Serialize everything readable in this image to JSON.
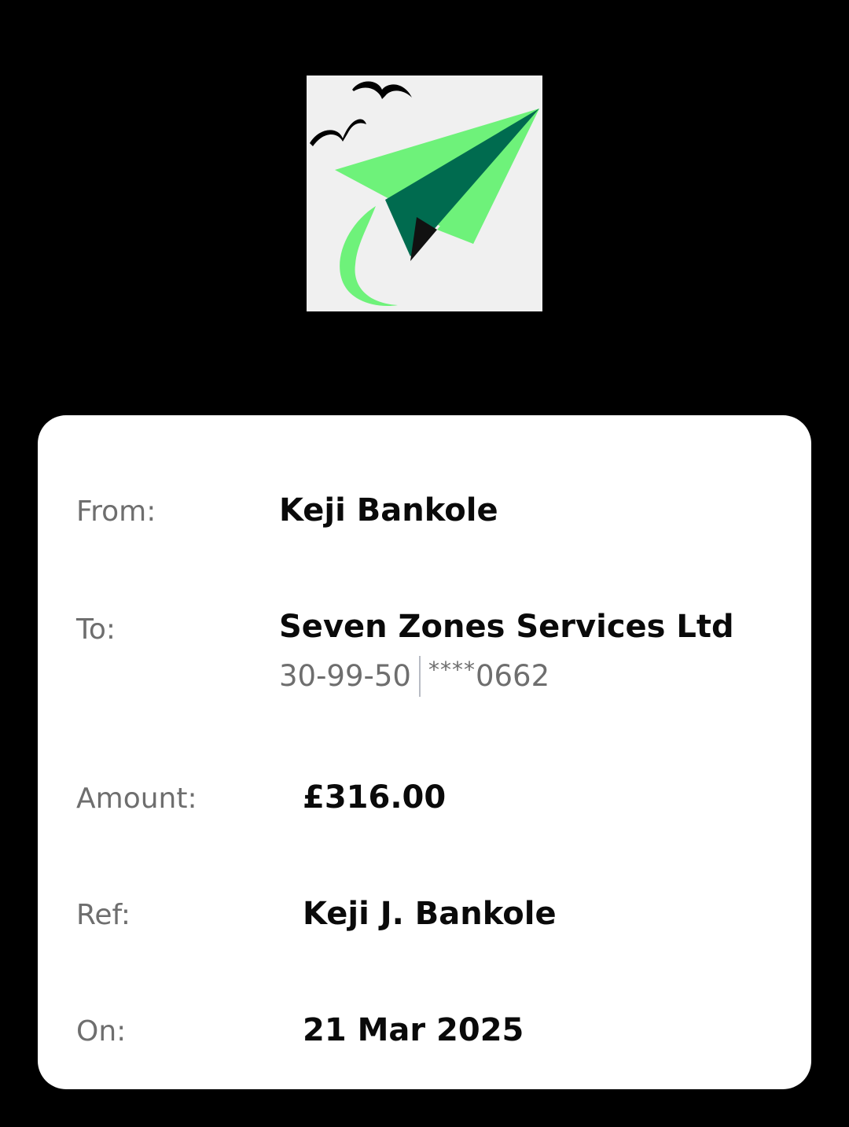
{
  "logo": {
    "icon": "paper-plane-logo",
    "colors": {
      "background": "#f0f0f0",
      "plane_light": "#6ef27a",
      "plane_dark": "#006b4f",
      "birds": "#000000"
    }
  },
  "receipt": {
    "from_label": "From:",
    "from_value": "Keji Bankole",
    "to_label": "To:",
    "to_value": "Seven Zones Services Ltd",
    "sort_code": "30-99-50",
    "account_masked": "****",
    "account_last4": "0662",
    "amount_label": "Amount:",
    "amount_value": "£316.00",
    "ref_label": "Ref:",
    "ref_value": "Keji J. Bankole",
    "on_label": "On:",
    "on_value": "21 Mar 2025"
  }
}
